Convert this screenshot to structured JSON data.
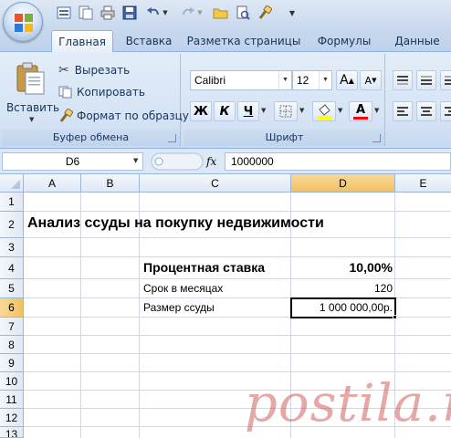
{
  "tabs": [
    {
      "label": "Главная",
      "active": true
    },
    {
      "label": "Вставка"
    },
    {
      "label": "Разметка страницы"
    },
    {
      "label": "Формулы"
    },
    {
      "label": "Данные"
    }
  ],
  "clipboard": {
    "paste_label": "Вставить",
    "cut_label": "Вырезать",
    "copy_label": "Копировать",
    "format_painter_label": "Формат по образцу",
    "group_label": "Буфер обмена"
  },
  "font": {
    "name": "Calibri",
    "size": "12",
    "bold": "Ж",
    "italic": "К",
    "underline": "Ч",
    "grow_symbol": "A",
    "shrink_symbol": "A",
    "font_color_symbol": "A",
    "group_label": "Шрифт",
    "highlight_color": "#ffff00",
    "font_color": "#ff0000"
  },
  "formula_bar": {
    "name_box": "D6",
    "fx_label": "fx",
    "value": "1000000"
  },
  "columns": [
    "A",
    "B",
    "C",
    "D",
    "E"
  ],
  "rows": [
    "1",
    "2",
    "3",
    "4",
    "5",
    "6",
    "7",
    "8",
    "9",
    "10",
    "11",
    "12",
    "13"
  ],
  "cells": {
    "A2": "Анализ ссуды на покупку недвижимости",
    "C4": "Процентная ставка",
    "D4": "10,00%",
    "C5": "Срок в месяцах",
    "D5": "120",
    "C6": "Размер ссуды",
    "D6": "1 000 000,00р."
  },
  "selected_cell": "D6",
  "watermark": "postila.ru"
}
